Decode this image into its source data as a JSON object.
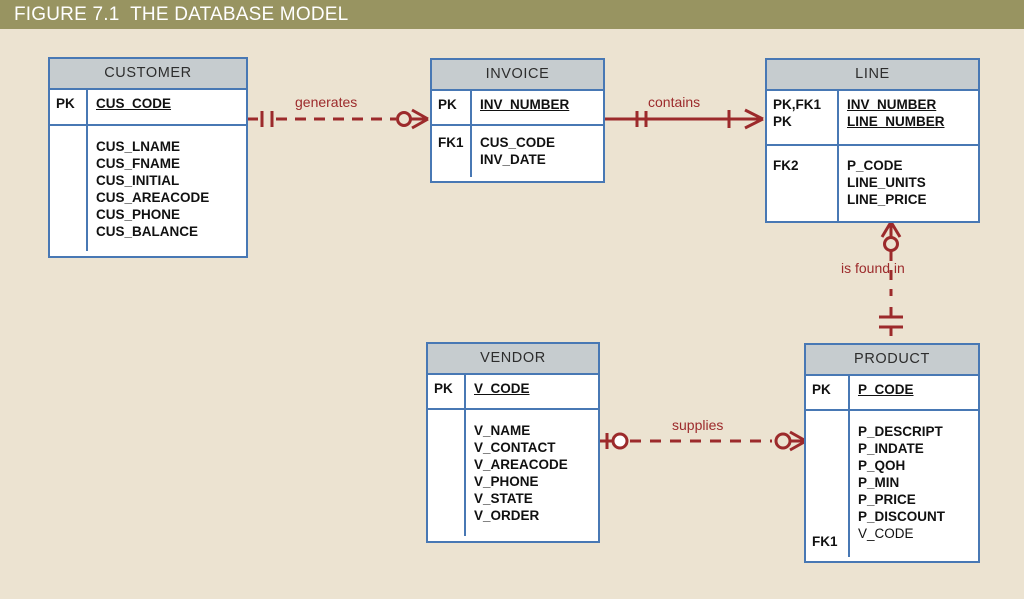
{
  "figure": {
    "number": "FIGURE 7.1",
    "title": "THE DATABASE MODEL",
    "header_color": "#989461",
    "background_color": "#ece3d1",
    "entity_border_color": "#4878b4",
    "entity_header_color": "#c6cccf",
    "relationship_color": "#9c2a2b"
  },
  "entities": [
    {
      "name": "CUSTOMER",
      "pk_keys": "PK",
      "pk_attrs": "CUS_CODE",
      "fk_keys": "",
      "attrs": "CUS_LNAME\nCUS_FNAME\nCUS_INITIAL\nCUS_AREACODE\nCUS_PHONE\nCUS_BALANCE"
    },
    {
      "name": "INVOICE",
      "pk_keys": "PK",
      "pk_attrs": "INV_NUMBER",
      "fk_keys": "FK1",
      "attrs": "CUS_CODE\nINV_DATE"
    },
    {
      "name": "LINE",
      "pk_keys": "PK,FK1\nPK",
      "pk_attrs": "INV_NUMBER\nLINE_NUMBER",
      "fk_keys": "FK2",
      "attrs": "P_CODE\nLINE_UNITS\nLINE_PRICE"
    },
    {
      "name": "VENDOR",
      "pk_keys": "PK",
      "pk_attrs": "V_CODE",
      "fk_keys": "",
      "attrs": "V_NAME\nV_CONTACT\nV_AREACODE\nV_PHONE\nV_STATE\nV_ORDER"
    },
    {
      "name": "PRODUCT",
      "pk_keys": "PK",
      "pk_attrs": "P_CODE",
      "fk_keys_top": "",
      "fk_keys_bottom": "FK1",
      "attrs": "P_DESCRIPT\nP_INDATE\nP_QOH\nP_MIN\nP_PRICE\nP_DISCOUNT",
      "attrs_last": "V_CODE"
    }
  ],
  "relationships": [
    {
      "label": "generates",
      "from": "CUSTOMER",
      "to": "INVOICE",
      "line_style": "dashed",
      "from_cardinality": "one-and-only-one",
      "to_cardinality": "zero-or-many"
    },
    {
      "label": "contains",
      "from": "INVOICE",
      "to": "LINE",
      "line_style": "solid",
      "from_cardinality": "one-and-only-one",
      "to_cardinality": "one-or-many"
    },
    {
      "label": "is found in",
      "from": "LINE",
      "to": "PRODUCT",
      "line_style": "dashed",
      "from_cardinality": "zero-or-many",
      "to_cardinality": "one-and-only-one"
    },
    {
      "label": "supplies",
      "from": "VENDOR",
      "to": "PRODUCT",
      "line_style": "dashed",
      "from_cardinality": "zero-or-one",
      "to_cardinality": "zero-or-many"
    }
  ]
}
